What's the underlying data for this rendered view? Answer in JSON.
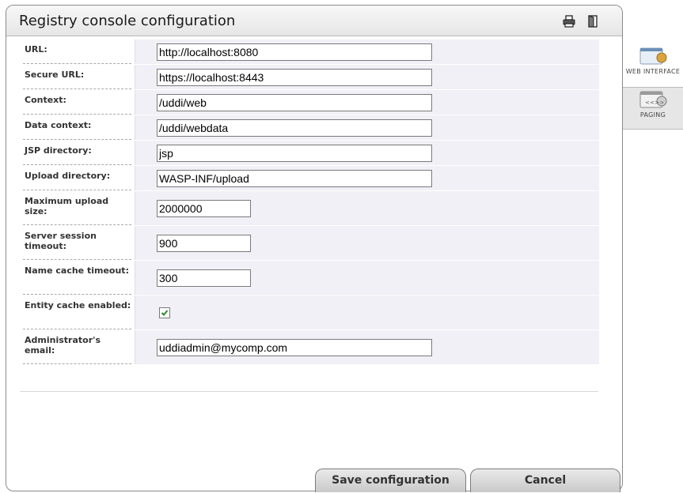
{
  "header": {
    "title": "Registry console configuration",
    "print_icon": "print-icon",
    "exit_icon": "exit-icon"
  },
  "side_tabs": [
    {
      "label": "WEB INTERFACE",
      "icon": "web-interface-icon"
    },
    {
      "label": "PAGING",
      "icon": "paging-icon"
    }
  ],
  "fields": {
    "url": {
      "label": "URL:",
      "value": "http://localhost:8080"
    },
    "secure_url": {
      "label": "Secure URL:",
      "value": "https://localhost:8443"
    },
    "context": {
      "label": "Context:",
      "value": "/uddi/web"
    },
    "data_context": {
      "label": "Data context:",
      "value": "/uddi/webdata"
    },
    "jsp_directory": {
      "label": "JSP directory:",
      "value": "jsp"
    },
    "upload_directory": {
      "label": "Upload directory:",
      "value": "WASP-INF/upload"
    },
    "max_upload_size": {
      "label": "Maximum upload size:",
      "value": "2000000"
    },
    "server_session_timeout": {
      "label": "Server session timeout:",
      "value": "900"
    },
    "name_cache_timeout": {
      "label": "Name cache timeout:",
      "value": "300"
    },
    "entity_cache_enabled": {
      "label": "Entity cache enabled:",
      "checked": true
    },
    "admin_email": {
      "label": "Administrator's email:",
      "value": "uddiadmin@mycomp.com"
    }
  },
  "buttons": {
    "save": "Save configuration",
    "cancel": "Cancel"
  }
}
